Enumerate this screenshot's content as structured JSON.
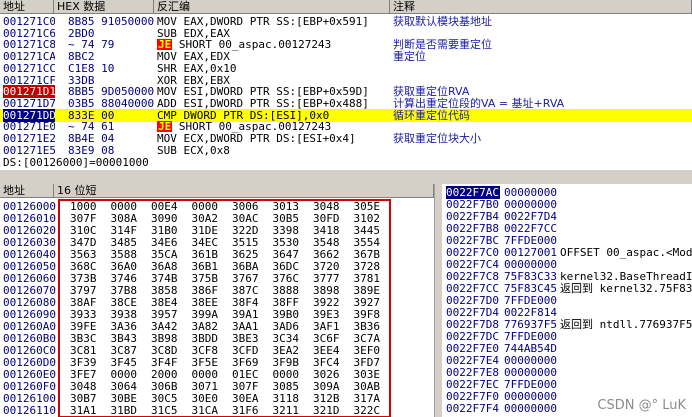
{
  "disasm": {
    "headers": {
      "addr": "地址",
      "hex": "HEX 数据",
      "asm": "反汇编",
      "comment": "注释"
    },
    "rows": [
      {
        "addr": "001271C0",
        "hex": "8B85 91050000",
        "asm": "MOV EAX,DWORD PTR SS:[EBP+0x591]",
        "comment": "获取默认模块基地址"
      },
      {
        "addr": "001271C6",
        "hex": "2BD0",
        "asm": "SUB EDX,EAX",
        "comment": ""
      },
      {
        "addr": "001271C8",
        "hex": "~ 74 79",
        "asm": "SHORT 00_aspac.00127243",
        "jmp": "JE",
        "comment": "判断是否需要重定位"
      },
      {
        "addr": "001271CA",
        "hex": "8BC2",
        "asm": "MOV EAX,EDX",
        "comment": "重定位"
      },
      {
        "addr": "001271CC",
        "hex": "C1E8 10",
        "asm": "SHR EAX,0x10",
        "comment": ""
      },
      {
        "addr": "001271CF",
        "hex": "33DB",
        "asm": "XOR EBX,EBX",
        "comment": ""
      },
      {
        "addr": "001271D1",
        "hex": "8BB5 9D050000",
        "asm": "MOV ESI,DWORD PTR SS:[EBP+0x59D]",
        "comment": "获取重定位RVA"
      },
      {
        "addr": "001271D7",
        "hex": "03B5 88040000",
        "asm": "ADD ESI,DWORD PTR SS:[EBP+0x488]",
        "comment": "计算出重定位段的VA = 基址+RVA"
      },
      {
        "addr": "001271DD",
        "hex": "833E 00",
        "asm": "CMP DWORD PTR DS:[ESI],0x0",
        "comment": "循环重定位代码"
      },
      {
        "addr": "001271E0",
        "hex": "~ 74 61",
        "asm": "SHORT 00_aspac.00127243",
        "jmp": "JE",
        "comment": ""
      },
      {
        "addr": "001271E2",
        "hex": "8B4E 04",
        "asm": "MOV ECX,DWORD PTR DS:[ESI+0x4]",
        "comment": "获取重定位块大小"
      },
      {
        "addr": "001271E5",
        "hex": "83E9 08",
        "asm": "SUB ECX,0x8",
        "comment": ""
      }
    ],
    "status": "DS:[00126000]=00001000"
  },
  "dump": {
    "headers": {
      "addr": "地址",
      "data": "16 位短"
    },
    "rows": [
      {
        "addr": "00126000",
        "vals": [
          "1000",
          "0000",
          "00E4",
          "0000",
          "3006",
          "3013",
          "3048",
          "305E"
        ]
      },
      {
        "addr": "00126010",
        "vals": [
          "307F",
          "308A",
          "3090",
          "30A2",
          "30AC",
          "30B5",
          "30FD",
          "3102"
        ]
      },
      {
        "addr": "00126020",
        "vals": [
          "310C",
          "314F",
          "31B0",
          "31DE",
          "322D",
          "3398",
          "3418",
          "3445"
        ]
      },
      {
        "addr": "00126030",
        "vals": [
          "347D",
          "3485",
          "34E6",
          "34EC",
          "3515",
          "3530",
          "3548",
          "3554"
        ]
      },
      {
        "addr": "00126040",
        "vals": [
          "3563",
          "3588",
          "35CA",
          "361B",
          "3625",
          "3647",
          "3662",
          "367B"
        ]
      },
      {
        "addr": "00126050",
        "vals": [
          "368C",
          "36A0",
          "36A8",
          "36B1",
          "36BA",
          "36DC",
          "3720",
          "3728"
        ]
      },
      {
        "addr": "00126060",
        "vals": [
          "373B",
          "3746",
          "374B",
          "375B",
          "3767",
          "376C",
          "3777",
          "3781"
        ]
      },
      {
        "addr": "00126070",
        "vals": [
          "3797",
          "37B8",
          "3858",
          "386F",
          "387C",
          "3888",
          "3898",
          "389E"
        ]
      },
      {
        "addr": "00126080",
        "vals": [
          "38AF",
          "38CE",
          "38E4",
          "38EE",
          "38F4",
          "38FF",
          "3922",
          "3927"
        ]
      },
      {
        "addr": "00126090",
        "vals": [
          "3933",
          "3938",
          "3957",
          "399A",
          "39A1",
          "39B0",
          "39E3",
          "39F8"
        ]
      },
      {
        "addr": "001260A0",
        "vals": [
          "39FE",
          "3A36",
          "3A42",
          "3A82",
          "3AA1",
          "3AD6",
          "3AF1",
          "3B36"
        ]
      },
      {
        "addr": "001260B0",
        "vals": [
          "3B3C",
          "3B43",
          "3B98",
          "3BDD",
          "3BE3",
          "3C34",
          "3C6F",
          "3C7A"
        ]
      },
      {
        "addr": "001260C0",
        "vals": [
          "3C81",
          "3C87",
          "3C8D",
          "3CF8",
          "3CFD",
          "3EA2",
          "3EE4",
          "3EF0"
        ]
      },
      {
        "addr": "001260D0",
        "vals": [
          "3F39",
          "3F45",
          "3F4F",
          "3F5E",
          "3F69",
          "3F9B",
          "3FC4",
          "3FD7"
        ]
      },
      {
        "addr": "001260E0",
        "vals": [
          "3FE7",
          "0000",
          "2000",
          "0000",
          "01EC",
          "0000",
          "3026",
          "303E"
        ]
      },
      {
        "addr": "001260F0",
        "vals": [
          "3048",
          "3064",
          "306B",
          "3071",
          "307F",
          "3085",
          "309A",
          "30AB"
        ]
      },
      {
        "addr": "00126100",
        "vals": [
          "30B7",
          "30BE",
          "30C5",
          "30E0",
          "30EA",
          "3118",
          "312B",
          "317A"
        ]
      },
      {
        "addr": "00126110",
        "vals": [
          "31A1",
          "31BD",
          "31C5",
          "31CA",
          "31F6",
          "3211",
          "321D",
          "322C"
        ]
      }
    ]
  },
  "stack": {
    "rows": [
      {
        "addr": "0022F7AC",
        "val": "00000000",
        "comment": "",
        "top": true
      },
      {
        "addr": "0022F7B0",
        "val": "00000000",
        "comment": ""
      },
      {
        "addr": "0022F7B4",
        "val": "0022F7D4",
        "comment": ""
      },
      {
        "addr": "0022F7B8",
        "val": "0022F7CC",
        "comment": ""
      },
      {
        "addr": "0022F7BC",
        "val": "7FFDE000",
        "comment": ""
      },
      {
        "addr": "0022F7C0",
        "val": "00127001",
        "comment": "OFFSET 00_aspac.<Module"
      },
      {
        "addr": "0022F7C4",
        "val": "00000000",
        "comment": ""
      },
      {
        "addr": "0022F7C8",
        "val": "75F83C33",
        "comment": "kernel32.BaseThreadInit"
      },
      {
        "addr": "0022F7CC",
        "val": "75F83C45",
        "comment": "返回到 kernel32.75F83C4"
      },
      {
        "addr": "0022F7D0",
        "val": "7FFDE000",
        "comment": ""
      },
      {
        "addr": "0022F7D4",
        "val": "0022F814",
        "comment": ""
      },
      {
        "addr": "0022F7D8",
        "val": "776937F5",
        "comment": "返回到 ntdll.776937F5"
      },
      {
        "addr": "0022F7DC",
        "val": "7FFDE000",
        "comment": ""
      },
      {
        "addr": "0022F7E0",
        "val": "744AB54D",
        "comment": ""
      },
      {
        "addr": "0022F7E4",
        "val": "00000000",
        "comment": ""
      },
      {
        "addr": "0022F7E8",
        "val": "00000000",
        "comment": ""
      },
      {
        "addr": "0022F7EC",
        "val": "7FFDE000",
        "comment": ""
      },
      {
        "addr": "0022F7F0",
        "val": "00000000",
        "comment": ""
      },
      {
        "addr": "0022F7F4",
        "val": "00000000",
        "comment": ""
      }
    ]
  },
  "watermark": "CSDN @° LuK",
  "colors": {
    "highlight": "#ffff00",
    "selected_addr_bg": "#c00000",
    "stack_top_bg": "#000080",
    "red_box": "#d80000"
  }
}
